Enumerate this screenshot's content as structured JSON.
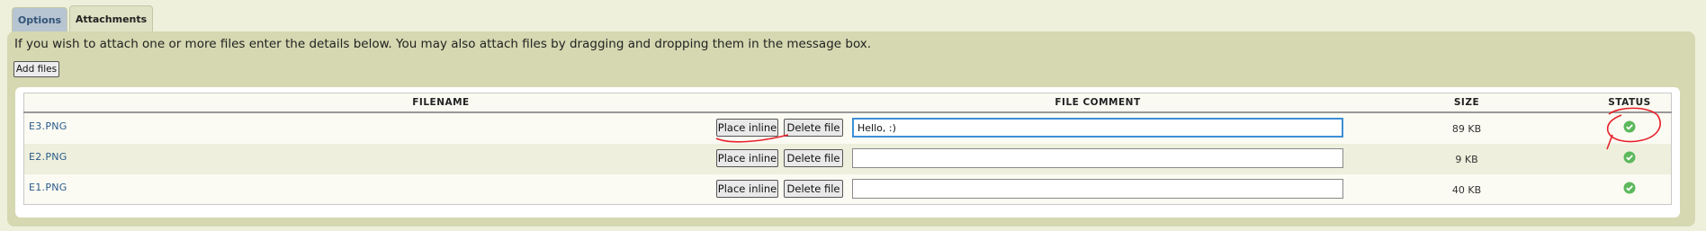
{
  "tabs": [
    {
      "label": "Options"
    },
    {
      "label": "Attachments"
    }
  ],
  "intro_text": "If you wish to attach one or more files enter the details below. You may also attach files by dragging and dropping them in the message box.",
  "add_files_label": "Add files",
  "table": {
    "headers": {
      "filename": "FILENAME",
      "comment": "FILE COMMENT",
      "size": "SIZE",
      "status": "STATUS"
    },
    "rows": [
      {
        "filename": "E3.PNG",
        "place_inline": "Place inline",
        "delete": "Delete file",
        "comment": "Hello, :)",
        "size": "89 KB",
        "status_icon": "check-circle-icon"
      },
      {
        "filename": "E2.PNG",
        "place_inline": "Place inline",
        "delete": "Delete file",
        "comment": "",
        "size": "9 KB",
        "status_icon": "check-circle-icon"
      },
      {
        "filename": "E1.PNG",
        "place_inline": "Place inline",
        "delete": "Delete file",
        "comment": "",
        "size": "40 KB",
        "status_icon": "check-circle-icon"
      }
    ]
  },
  "colors": {
    "status_ok": "#5cb85c",
    "annotation": "#e8202a",
    "link": "#2a5b8a"
  }
}
